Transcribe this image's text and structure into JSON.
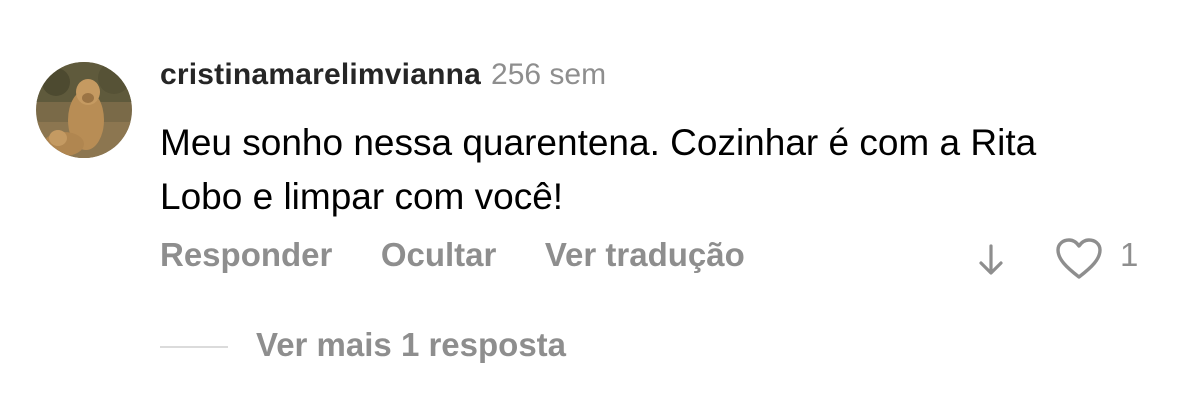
{
  "comment": {
    "username": "cristinamarelimvianna",
    "time": "256 sem",
    "text": "Meu sonho nessa quarentena. Cozinhar é com a Rita Lobo e limpar com você!",
    "actions": {
      "reply": "Responder",
      "hide": "Ocultar",
      "translate": "Ver tradução"
    },
    "likes": "1",
    "view_more_replies": "Ver mais 1 resposta"
  },
  "icons": {
    "down": "arrow-down-icon",
    "like": "heart-outline-icon"
  },
  "colors": {
    "username": "#262626",
    "secondary": "#8e8e8e",
    "divider": "#dbdbdb"
  }
}
